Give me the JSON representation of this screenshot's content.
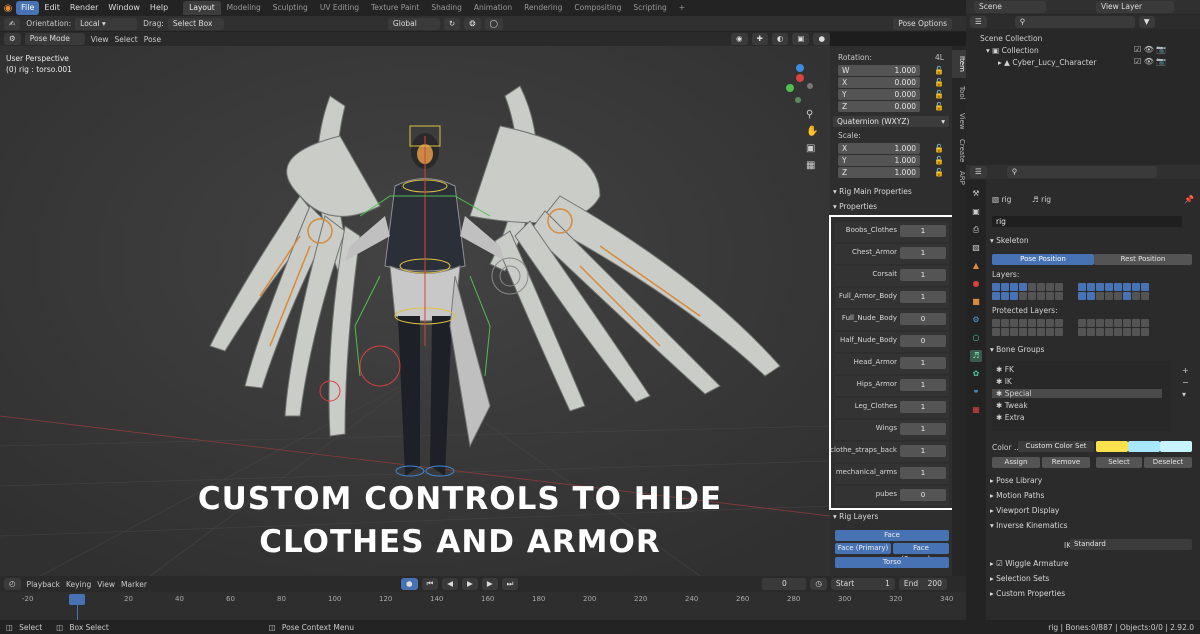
{
  "topbar": {
    "menus": [
      "File",
      "Edit",
      "Render",
      "Window",
      "Help"
    ],
    "workspaces": [
      "Layout",
      "Modeling",
      "Sculpting",
      "UV Editing",
      "Texture Paint",
      "Shading",
      "Animation",
      "Rendering",
      "Compositing",
      "Scripting"
    ],
    "add_tab": "+"
  },
  "header": {
    "orientation_label": "Orientation:",
    "orientation_value": "Local",
    "drag_label": "Drag:",
    "drag_value": "Select Box",
    "transform_orientation": "Global",
    "pose_options": "Pose Options",
    "mode": "Pose Mode",
    "menu_view": "View",
    "menu_select": "Select",
    "menu_pose": "Pose"
  },
  "viewport": {
    "perspective": "User Perspective",
    "object_info": "(0) rig : torso.001",
    "overlay_line1": "CUSTOM CONTROLS TO HIDE",
    "overlay_line2": "CLOTHES AND ARMOR"
  },
  "npanel": {
    "rotation_label": "Rotation:",
    "rotation_mode_short": "4L",
    "rotation": [
      {
        "axis": "W",
        "value": "1.000"
      },
      {
        "axis": "X",
        "value": "0.000"
      },
      {
        "axis": "Y",
        "value": "0.000"
      },
      {
        "axis": "Z",
        "value": "0.000"
      }
    ],
    "rotation_mode": "Quaternion (WXYZ)",
    "scale_label": "Scale:",
    "scale": [
      {
        "axis": "X",
        "value": "1.000"
      },
      {
        "axis": "Y",
        "value": "1.000"
      },
      {
        "axis": "Z",
        "value": "1.000"
      }
    ],
    "rig_main_properties": "Rig Main Properties",
    "properties_header": "Properties",
    "properties": [
      {
        "label": "Boobs_Clothes",
        "value": "1"
      },
      {
        "label": "Chest_Armor",
        "value": "1"
      },
      {
        "label": "Corsait",
        "value": "1"
      },
      {
        "label": "Full_Armor_Body",
        "value": "1"
      },
      {
        "label": "Full_Nude_Body",
        "value": "0"
      },
      {
        "label": "Half_Nude_Body",
        "value": "0"
      },
      {
        "label": "Head_Armor",
        "value": "1"
      },
      {
        "label": "Hips_Armor",
        "value": "1"
      },
      {
        "label": "Leg_Clothes",
        "value": "1"
      },
      {
        "label": "Wings",
        "value": "1"
      },
      {
        "label": "clothe_straps_back",
        "value": "1"
      },
      {
        "label": "mechanical_arms",
        "value": "1"
      },
      {
        "label": "pubes",
        "value": "0"
      }
    ],
    "rig_layers": "Rig Layers",
    "layer_buttons": [
      "Face",
      "Face (Primary)",
      "Face (Secondar..",
      "Torso"
    ],
    "tabs": [
      "Item",
      "Tool",
      "View",
      "Create",
      "ARP"
    ]
  },
  "outliner": {
    "scene": "Scene",
    "view_layer": "View Layer",
    "scene_collection": "Scene Collection",
    "collection": "Collection",
    "object": "Cyber_Lucy_Character"
  },
  "properties_editor": {
    "object_name": "rig",
    "data_name": "rig",
    "data_field": "rig",
    "skeleton": "Skeleton",
    "pose_position": "Pose Position",
    "rest_position": "Rest Position",
    "layers_label": "Layers:",
    "protected_layers_label": "Protected Layers:",
    "bone_groups": "Bone Groups",
    "groups": [
      "FK",
      "IK",
      "Special",
      "Tweak",
      "Extra"
    ],
    "color_label": "Color ..",
    "color_set": "Custom Color Set",
    "assign": "Assign",
    "remove": "Remove",
    "select": "Select",
    "deselect": "Deselect",
    "sections": [
      "Pose Library",
      "Motion Paths",
      "Viewport Display",
      "Inverse Kinematics"
    ],
    "ik_solver_label": "IK Solver",
    "ik_solver_value": "Standard",
    "wiggle_armature": "Wiggle Armature",
    "selection_sets": "Selection Sets",
    "custom_properties": "Custom Properties",
    "colors": {
      "yellow": "#ffe14d",
      "cyan": "#a8e8ff",
      "pale": "#c8f4ff"
    }
  },
  "timeline": {
    "menus": [
      "Playback",
      "Keying",
      "View",
      "Marker"
    ],
    "current_frame": "0",
    "start_label": "Start",
    "start_value": "1",
    "end_label": "End",
    "end_value": "200",
    "ticks": [
      "-20",
      "0",
      "20",
      "40",
      "60",
      "80",
      "100",
      "120",
      "140",
      "160",
      "180",
      "200",
      "220",
      "240",
      "260",
      "280",
      "300",
      "320",
      "340"
    ]
  },
  "statusbar": {
    "select": "Select",
    "box_select": "Box Select",
    "pose_context_menu": "Pose Context Menu",
    "stats": "rig | Bones:0/887 | Objects:0/0 | 2.92.0"
  },
  "colors": {
    "accent": "#4772b3",
    "orange": "#e88b2e"
  }
}
